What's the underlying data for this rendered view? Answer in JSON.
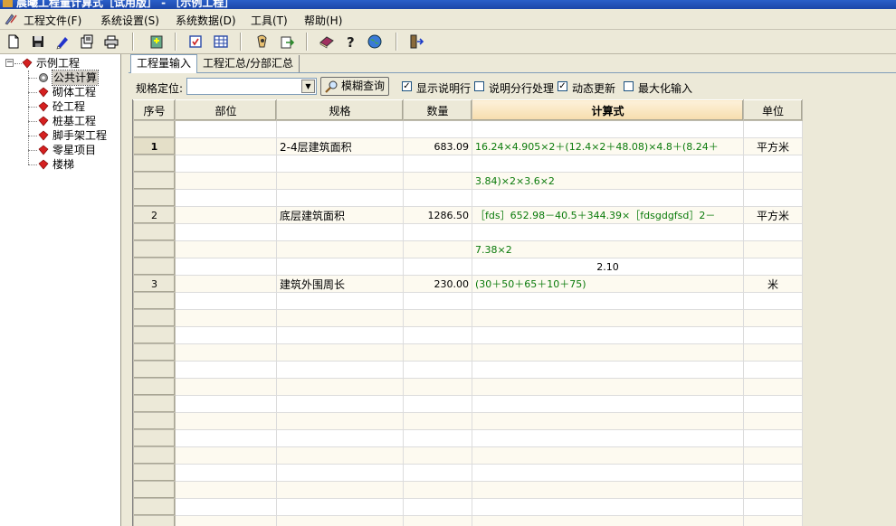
{
  "window": {
    "title": "晨曦工程量计算式［试用版］ - ［示例工程］"
  },
  "menu": [
    {
      "label": "工程文件(F)",
      "name": "menu-project-file"
    },
    {
      "label": "系统设置(S)",
      "name": "menu-system-settings"
    },
    {
      "label": "系统数据(D)",
      "name": "menu-system-data"
    },
    {
      "label": "工具(T)",
      "name": "menu-tools"
    },
    {
      "label": "帮助(H)",
      "name": "menu-help"
    }
  ],
  "toolbar": {
    "icons": [
      "new-file-icon",
      "save-icon",
      "edit-icon",
      "properties-icon",
      "print-icon",
      "import-icon",
      "check-icon",
      "table-icon",
      "calculator-icon",
      "export-icon",
      "book-icon",
      "help-icon",
      "globe-icon",
      "exit-icon"
    ]
  },
  "tree": {
    "root": "示例工程",
    "items": [
      "公共计算",
      "砌体工程",
      "砼工程",
      "桩基工程",
      "脚手架工程",
      "零星项目",
      "楼梯"
    ],
    "selected_index": 0
  },
  "tabs": [
    "工程量输入",
    "工程汇总/分部汇总"
  ],
  "filter": {
    "label": "规格定位:",
    "combo_value": "",
    "search_button": "模糊查询",
    "checkboxes": [
      {
        "label": "显示说明行",
        "checked": true
      },
      {
        "label": "说明分行处理",
        "checked": false
      },
      {
        "label": "动态更新",
        "checked": true
      },
      {
        "label": "最大化输入",
        "checked": false
      }
    ]
  },
  "grid": {
    "headers": [
      "序号",
      "部位",
      "规格",
      "数量",
      "计算式",
      "单位"
    ],
    "rows": [
      {
        "seq": "",
        "part": "",
        "spec": "",
        "qty": "",
        "formula": "",
        "unit": ""
      },
      {
        "seq": "1",
        "part": "",
        "spec": "2-4层建筑面积",
        "qty": "683.09",
        "formula": "16.24×4.905×2＋(12.4×2＋48.08)×4.8＋(8.24＋",
        "unit": "平方米",
        "current": true
      },
      {
        "seq": "",
        "part": "",
        "spec": "",
        "qty": "",
        "formula": "",
        "unit": ""
      },
      {
        "seq": "",
        "part": "",
        "spec": "",
        "qty": "",
        "formula": "3.84)×2×3.6×2",
        "unit": ""
      },
      {
        "seq": "",
        "part": "",
        "spec": "",
        "qty": "",
        "formula": "",
        "unit": ""
      },
      {
        "seq": "2",
        "part": "",
        "spec": "底层建筑面积",
        "qty": "1286.50",
        "formula": "［fds］652.98－40.5＋344.39×［fdsgdgfsd］2－",
        "unit": "平方米"
      },
      {
        "seq": "",
        "part": "",
        "spec": "",
        "qty": "",
        "formula": "",
        "unit": ""
      },
      {
        "seq": "",
        "part": "",
        "spec": "",
        "qty": "",
        "formula": "7.38×2",
        "unit": ""
      },
      {
        "seq": "",
        "part": "",
        "spec": "",
        "qty": "",
        "formula": "2.10",
        "unit": "",
        "result": true
      },
      {
        "seq": "3",
        "part": "",
        "spec": "建筑外围周长",
        "qty": "230.00",
        "formula": "(30＋50＋65＋10＋75)",
        "unit": "米"
      },
      {
        "seq": "",
        "part": "",
        "spec": "",
        "qty": "",
        "formula": "",
        "unit": ""
      },
      {
        "seq": "",
        "part": "",
        "spec": "",
        "qty": "",
        "formula": "",
        "unit": ""
      },
      {
        "seq": "",
        "part": "",
        "spec": "",
        "qty": "",
        "formula": "",
        "unit": ""
      },
      {
        "seq": "",
        "part": "",
        "spec": "",
        "qty": "",
        "formula": "",
        "unit": ""
      },
      {
        "seq": "",
        "part": "",
        "spec": "",
        "qty": "",
        "formula": "",
        "unit": ""
      },
      {
        "seq": "",
        "part": "",
        "spec": "",
        "qty": "",
        "formula": "",
        "unit": ""
      },
      {
        "seq": "",
        "part": "",
        "spec": "",
        "qty": "",
        "formula": "",
        "unit": ""
      },
      {
        "seq": "",
        "part": "",
        "spec": "",
        "qty": "",
        "formula": "",
        "unit": ""
      },
      {
        "seq": "",
        "part": "",
        "spec": "",
        "qty": "",
        "formula": "",
        "unit": ""
      },
      {
        "seq": "",
        "part": "",
        "spec": "",
        "qty": "",
        "formula": "",
        "unit": ""
      },
      {
        "seq": "",
        "part": "",
        "spec": "",
        "qty": "",
        "formula": "",
        "unit": ""
      },
      {
        "seq": "",
        "part": "",
        "spec": "",
        "qty": "",
        "formula": "",
        "unit": ""
      },
      {
        "seq": "",
        "part": "",
        "spec": "",
        "qty": "",
        "formula": "",
        "unit": ""
      },
      {
        "seq": "",
        "part": "",
        "spec": "",
        "qty": "",
        "formula": "",
        "unit": ""
      }
    ]
  }
}
